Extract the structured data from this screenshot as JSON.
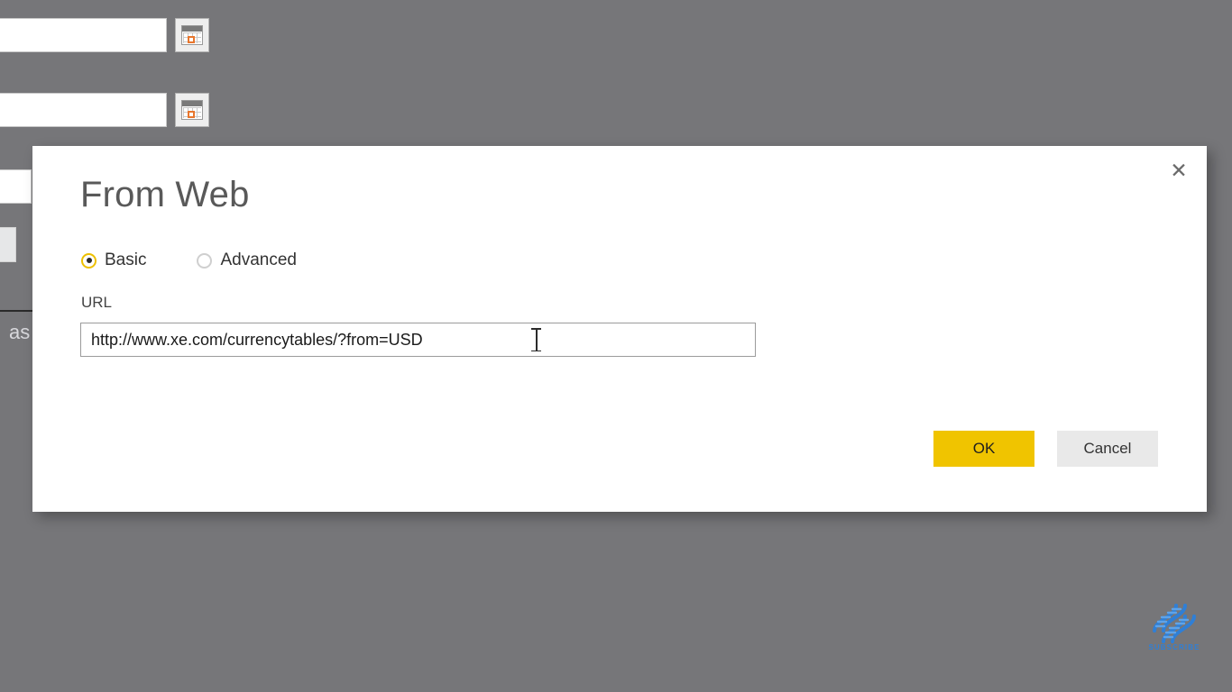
{
  "backdrop": {
    "color": "#767679",
    "date_rows": [
      {
        "icon": "calendar-icon",
        "value": ""
      },
      {
        "icon": "calendar-icon",
        "value": ""
      }
    ],
    "fragment_text": "as"
  },
  "watermark": {
    "icon": "dna-helix-icon",
    "label": "SUBSCRIBE",
    "color": "#2f7fd6"
  },
  "dialog": {
    "title": "From Web",
    "close_icon": "close-icon",
    "close_label": "✕",
    "mode": {
      "selected": "Basic",
      "options": [
        {
          "label": "Basic",
          "checked": true
        },
        {
          "label": "Advanced",
          "checked": false
        }
      ]
    },
    "url_field": {
      "label": "URL",
      "value": "http://www.xe.com/currencytables/?from=USD",
      "placeholder": "http://"
    },
    "buttons": {
      "ok": "OK",
      "cancel": "Cancel"
    },
    "accent_color": "#f0c400"
  }
}
